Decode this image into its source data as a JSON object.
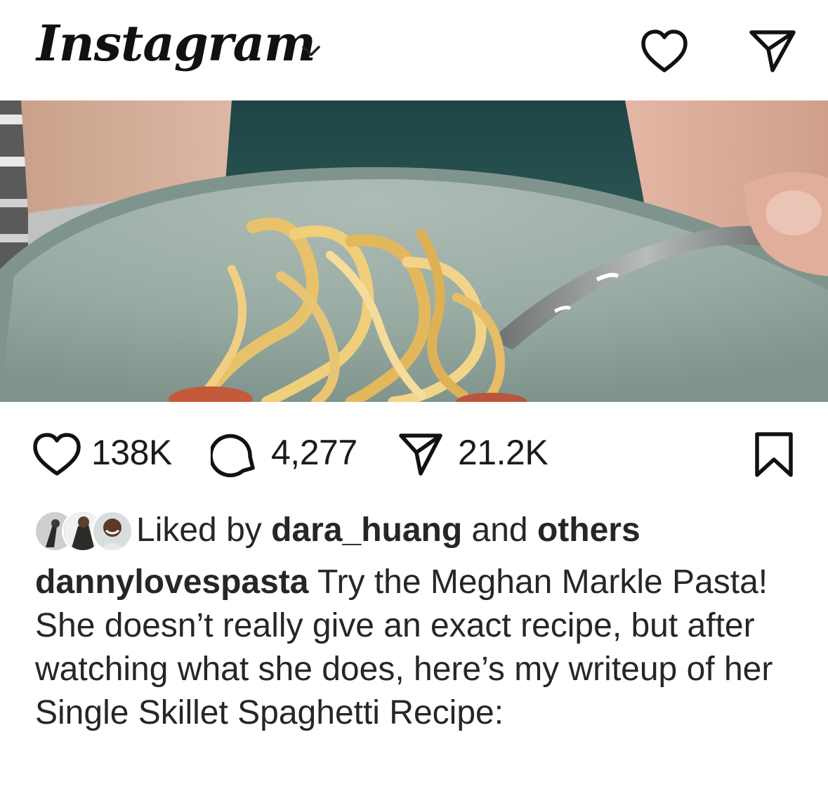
{
  "app": {
    "title": "Instagram"
  },
  "header": {
    "icons": [
      "chevron-down-icon",
      "heart-icon",
      "send-icon"
    ]
  },
  "post": {
    "image_description_icon": "photo",
    "actions": {
      "likes": "138K",
      "comments": "4,277",
      "shares": "21.2K",
      "icons": [
        "heart-icon",
        "comment-icon",
        "send-icon",
        "bookmark-icon"
      ]
    },
    "liked_by": {
      "prefix": "Liked by",
      "user": "dara_huang",
      "and": "and",
      "others": "others"
    },
    "caption": {
      "username": "dannylovespasta",
      "text": "Try the Meghan Markle Pasta! She doesn’t really give an exact recipe, but after watching what she does, here’s my writeup of her Single Skillet Spaghetti Recipe:"
    }
  },
  "colors": {
    "text": "#262626",
    "background": "#ffffff",
    "bowl": "#8fa39c"
  }
}
